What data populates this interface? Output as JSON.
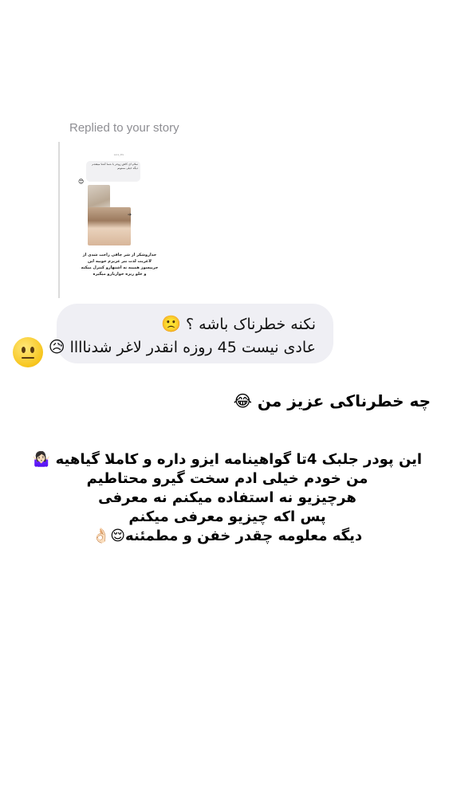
{
  "story_reply": {
    "label": "Replied to your story",
    "thumbnail": {
      "header": "sara_life",
      "bubble_text": "سلام ای کاش زودتر با شما آشنا میشدم دیگه خیلی ممنونم",
      "caption": "خداروشکر از شر چاقی راحت شدی از لاغریت لذت ببر عزیزم خوبیه این جریپسوز همینه نه اشتهارو کنترل میکنه و خلو ریزه خواریارو میگیره"
    }
  },
  "message_bubble": {
    "line1": "نکنه خطرناک باشه ؟",
    "line1_emoji": "🙁",
    "line2": "عادی نیست 45 روزه انقدر لاغر شدناااا",
    "line2_emoji": "😥"
  },
  "sender_avatar": {
    "icon": "neutral-face-emoji"
  },
  "story_overlay": {
    "headline": "چه خطرناکی عزیز من",
    "headline_emoji": "😂",
    "lines": [
      "این پودر جلبک 4تا گواهینامه ایزو داره و کاملا گیاهیه 🤷🏻‍♀️",
      "من خودم خیلی ادم سخت گیرو محتاطیم",
      "هرچیزیو نه استفاده میکنم نه معرفی",
      "پس اکه چیزیو معرفی میکنم",
      "دیگه معلومه چقدر خفن و مطمئنه😌👌🏻"
    ]
  }
}
